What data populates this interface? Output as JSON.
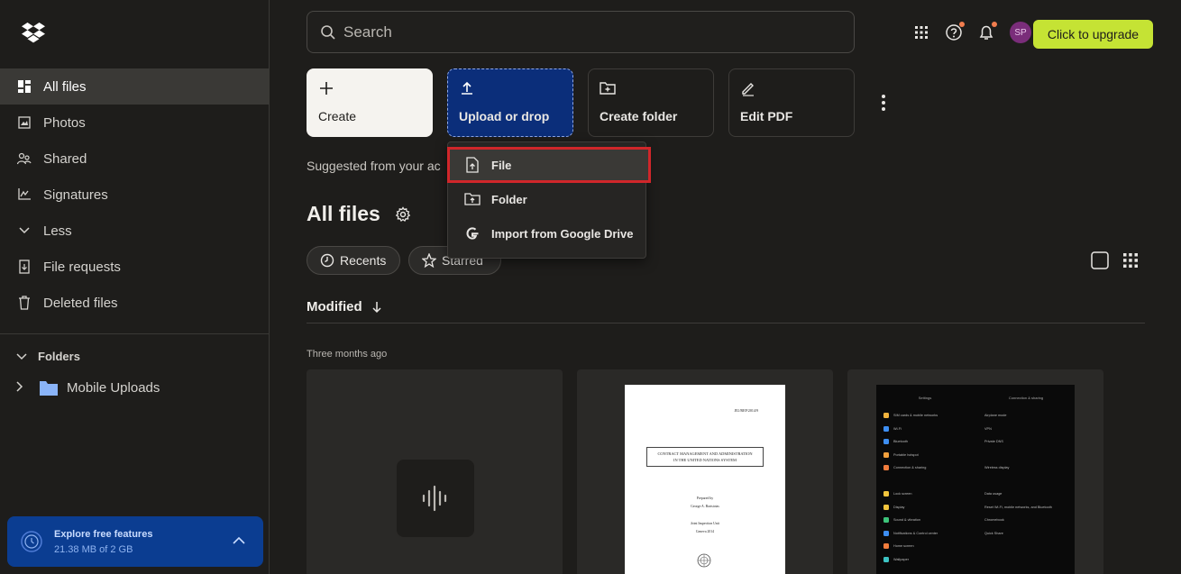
{
  "sidebar": {
    "items": [
      {
        "label": "All files",
        "icon": "all-files-icon",
        "active": true
      },
      {
        "label": "Photos",
        "icon": "photo-icon"
      },
      {
        "label": "Shared",
        "icon": "shared-icon"
      },
      {
        "label": "Signatures",
        "icon": "signature-icon"
      },
      {
        "label": "Less",
        "icon": "chevron-down-icon"
      },
      {
        "label": "File requests",
        "icon": "file-request-icon"
      },
      {
        "label": "Deleted files",
        "icon": "trash-icon"
      }
    ],
    "folders_heading": "Folders",
    "folder_item": "Mobile Uploads",
    "explore": {
      "title": "Explore free features",
      "usage": "21.38 MB of 2 GB"
    }
  },
  "header": {
    "search_placeholder": "Search",
    "avatar_initials": "SP",
    "upgrade_label": "Click to upgrade"
  },
  "actions": {
    "create": "Create",
    "upload": "Upload or drop",
    "create_folder": "Create folder",
    "edit_pdf": "Edit PDF"
  },
  "dropdown": {
    "items": [
      "File",
      "Folder",
      "Import from Google Drive"
    ]
  },
  "suggested_text": "Suggested from your ac",
  "main": {
    "title": "All files",
    "chips": [
      "Recents",
      "Starred"
    ],
    "sort_label": "Modified",
    "group_label": "Three months ago"
  },
  "doc_preview": {
    "ref": "JIU/REP/2014/9",
    "title_line1": "CONTRACT MANAGEMENT AND ADMINISTRATION",
    "title_line2": "IN THE UNITED NATIONS SYSTEM",
    "prepared": "Prepared by",
    "author": "George A. Bartsiotas",
    "unit": "Joint Inspection Unit",
    "place": "Geneva 2014"
  },
  "phone_preview": {
    "left_title": "Settings",
    "left_items": [
      "SIM cards & mobile networks",
      "Wi-Fi",
      "Bluetooth",
      "Portable hotspot",
      "Connection & sharing",
      "",
      "Lock screen",
      "Display",
      "Sound & vibration",
      "Notifications & Control center",
      "Home screen",
      "Wallpaper"
    ],
    "right_title": "Connection & sharing",
    "right_items": [
      "Airplane mode",
      "VPN",
      "Private DNS",
      "",
      "Wireless display",
      "",
      "Data usage",
      "Reset Wi-Fi, mobile networks, and Bluetooth",
      "Chromebook",
      "Quick Share"
    ]
  },
  "colors": {
    "accent": "#c5e334",
    "upload_tile": "#0b2e7a",
    "highlight_border": "#d0262a"
  }
}
